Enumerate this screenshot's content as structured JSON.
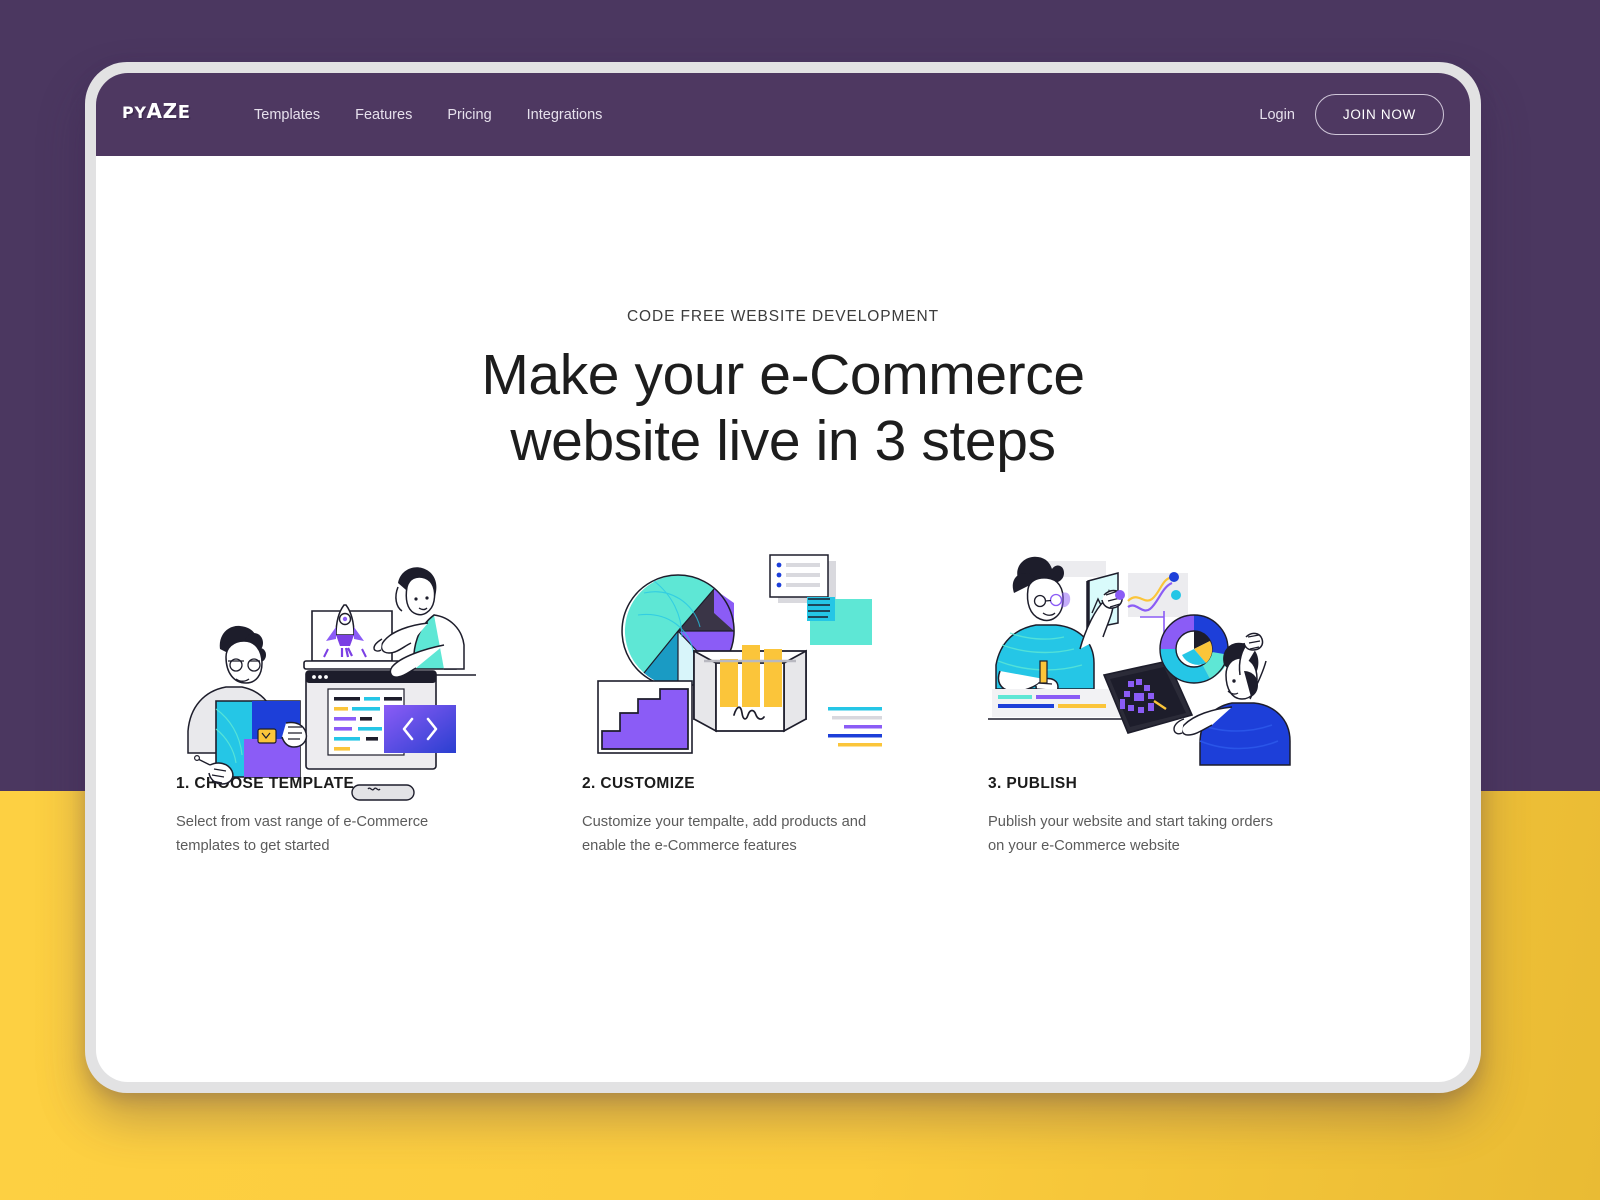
{
  "brand": {
    "logo_text": "PYAZE",
    "logo_part1": "PY",
    "logo_part2": "AZ",
    "logo_part3": "E",
    "header_color": "#4E3861",
    "page_bg_purple": "#4B3760",
    "page_bg_yellow": "#FCCE3F",
    "frame_border_color": "#E2E2E3"
  },
  "nav": {
    "links": [
      {
        "label": "Templates",
        "name": "nav-link-templates"
      },
      {
        "label": "Features",
        "name": "nav-link-features"
      },
      {
        "label": "Pricing",
        "name": "nav-link-pricing"
      },
      {
        "label": "Integrations",
        "name": "nav-link-integrations"
      }
    ],
    "login_label": "Login",
    "join_label": "JOIN NOW"
  },
  "hero": {
    "eyebrow": "CODE FREE WEBSITE DEVELOPMENT",
    "headline_line1": "Make your e-Commerce",
    "headline_line2": "website live in 3 steps"
  },
  "steps": [
    {
      "title": "1. CHOOSE TEMPLATE",
      "description": "Select from vast range of e-Commerce templates to get started",
      "art_name": "choose-template-illustration"
    },
    {
      "title": "2. CUSTOMIZE",
      "description": "Customize your tempalte, add products and enable the e-Commerce features",
      "art_name": "customize-illustration"
    },
    {
      "title": "3. PUBLISH",
      "description": "Publish your website and start taking orders on your e-Commerce website",
      "art_name": "publish-illustration"
    }
  ],
  "palette": {
    "purple": "#7B3FE4",
    "violet": "#8B5CF6",
    "teal": "#5EE7D5",
    "cyan": "#25C6E6",
    "blue": "#1D3FD9",
    "yellow": "#FBC53A",
    "dark": "#1D1D2B",
    "grey": "#D8D8DE"
  }
}
